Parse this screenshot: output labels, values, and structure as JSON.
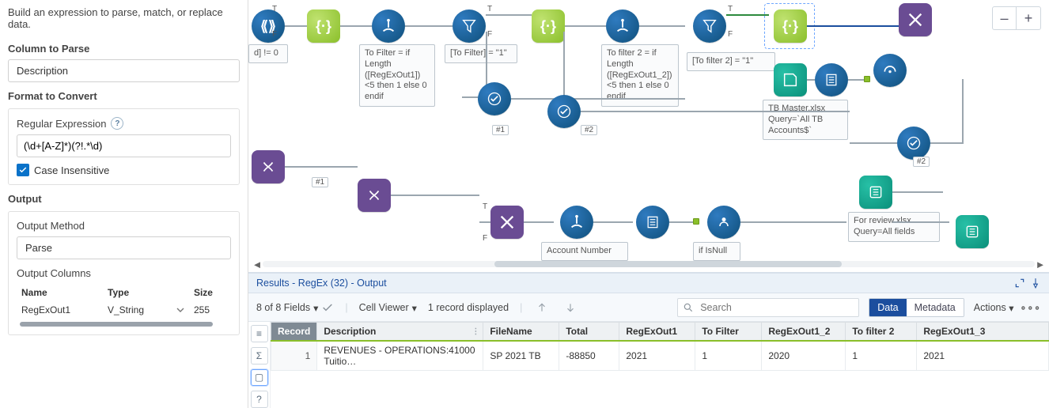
{
  "left": {
    "intro": "Build an expression to parse, match, or replace data.",
    "column_label": "Column to Parse",
    "column_value": "Description",
    "format_label": "Format to Convert",
    "regex_label": "Regular Expression",
    "regex_value": "(\\d+[A-Z]*)(?!.*\\d)",
    "case_insensitive_label": "Case Insensitive",
    "output_label": "Output",
    "output_method_label": "Output Method",
    "output_method_value": "Parse",
    "output_columns_label": "Output Columns",
    "out_cols": {
      "headers": {
        "name": "Name",
        "type": "Type",
        "size": "Size"
      },
      "rows": [
        {
          "name": "RegExOut1",
          "type": "V_String",
          "size": "255"
        }
      ]
    }
  },
  "canvas": {
    "zoom_minus": "–",
    "zoom_plus": "+",
    "anno_dynamic": "d] != 0",
    "anno_tofilter1": "To Filter = if Length ([RegExOut1])<5 then 1 else 0 endif",
    "anno_tofilter_eq": "[To Filter] = \"1\"",
    "anno_tofilter2": "To filter 2 = if Length ([RegExOut1_2])<5 then 1 else 0 endif",
    "anno_tofilter2_eq": "[To filter 2] = \"1\"",
    "anno_tbmaster": "TB Master.xlsx Query=`All TB Accounts$`",
    "anno_forreview": "For review.xlsx Query=All fields",
    "anno_account": "Account Number",
    "anno_isnull": "if IsNull",
    "lab_hash1": "#1",
    "lab_hash2": "#2",
    "port_t": "T",
    "port_f": "F"
  },
  "results": {
    "title": "Results - RegEx (32) - Output",
    "fields_text": "8 of 8 Fields",
    "cell_viewer": "Cell Viewer",
    "records_text": "1 record displayed",
    "search_placeholder": "Search",
    "seg_data": "Data",
    "seg_metadata": "Metadata",
    "actions_label": "Actions",
    "columns": [
      "Record",
      "Description",
      "FileName",
      "Total",
      "RegExOut1",
      "To Filter",
      "RegExOut1_2",
      "To filter 2",
      "RegExOut1_3"
    ],
    "rows": [
      {
        "n": "1",
        "Description": "REVENUES - OPERATIONS:41000 Tuitio…",
        "FileName": "SP 2021 TB",
        "Total": "-88850",
        "RegExOut1": "2021",
        "To Filter": "1",
        "RegExOut1_2": "2020",
        "To filter 2": "1",
        "RegExOut1_3": "2021"
      }
    ]
  },
  "chart_data": {
    "type": "table",
    "title": "Results - RegEx (32) - Output",
    "categories": [
      "Description",
      "FileName",
      "Total",
      "RegExOut1",
      "To Filter",
      "RegExOut1_2",
      "To filter 2",
      "RegExOut1_3"
    ],
    "series": [
      {
        "name": "row1",
        "values": [
          "REVENUES - OPERATIONS:41000 Tuitio…",
          "SP 2021 TB",
          -88850,
          2021,
          1,
          2020,
          1,
          2021
        ]
      }
    ]
  }
}
